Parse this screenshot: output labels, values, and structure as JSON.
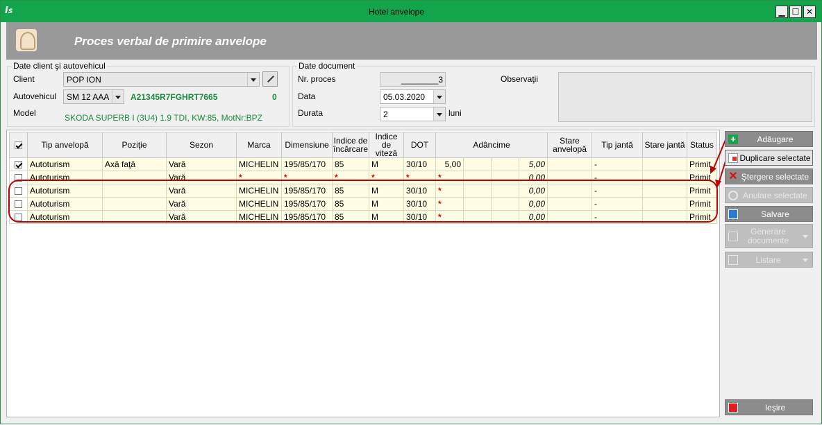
{
  "window": {
    "title": "Hotel anvelope",
    "min": "▁",
    "max": "☐",
    "close": "✕"
  },
  "header": {
    "title": "Proces verbal de primire anvelope"
  },
  "client_group": {
    "title": "Date client şi autovehicul",
    "client_label": "Client",
    "client_value": "POP ION",
    "vehicle_label": "Autovehicul",
    "vehicle_value": "SM 12 AAA",
    "vin": "A21345R7FGHRT7665",
    "vin_count": "0",
    "model_label": "Model",
    "model_value": "SKODA SUPERB I (3U4) 1.9 TDI, KW:85, MotNr:BPZ"
  },
  "document_group": {
    "title": "Date document",
    "nr_label": "Nr. proces",
    "nr_value": "________3",
    "date_label": "Data",
    "date_value": "05.03.2020",
    "duration_label": "Durata",
    "duration_value": "2",
    "duration_unit": "luni",
    "obs_label": "Observaţii"
  },
  "grid": {
    "headers": {
      "tip": "Tip anvelopă",
      "pozitie": "Poziţie",
      "sezon": "Sezon",
      "marca": "Marca",
      "dim": "Dimensiune",
      "incarcare": "Indice de încărcare",
      "viteza": "Indice de viteză",
      "dot": "DOT",
      "adancime": "Adâncime",
      "stare": "Stare anvelopă",
      "tip_janta": "Tip jantă",
      "stare_janta": "Stare jantă",
      "status": "Status"
    },
    "rows": [
      {
        "checked": true,
        "tip": "Autoturism",
        "pozitie": "Axă faţă",
        "sezon": "Vară",
        "marca": "MICHELIN",
        "dim": "195/85/170",
        "incarcare": "85",
        "viteza": "M",
        "dot": "30/10",
        "d1": "5,00",
        "total": "5,00",
        "tip_janta": "-",
        "status": "Primit"
      },
      {
        "checked": false,
        "tip": "Autoturism",
        "pozitie": "",
        "sezon": "Vară",
        "marca": "*",
        "dim": "*",
        "incarcare": "*",
        "viteza": "*",
        "dot": "*",
        "d1": "*",
        "total": "0,00",
        "tip_janta": "-",
        "status": "Primit"
      },
      {
        "checked": false,
        "tip": "Autoturism",
        "pozitie": "",
        "sezon": "Vară",
        "marca": "MICHELIN",
        "dim": "195/85/170",
        "incarcare": "85",
        "viteza": "M",
        "dot": "30/10",
        "d1": "*",
        "total": "0,00",
        "tip_janta": "-",
        "status": "Primit"
      },
      {
        "checked": false,
        "tip": "Autoturism",
        "pozitie": "",
        "sezon": "Vară",
        "marca": "MICHELIN",
        "dim": "195/85/170",
        "incarcare": "85",
        "viteza": "M",
        "dot": "30/10",
        "d1": "*",
        "total": "0,00",
        "tip_janta": "-",
        "status": "Primit"
      },
      {
        "checked": false,
        "tip": "Autoturism",
        "pozitie": "",
        "sezon": "Vară",
        "marca": "MICHELIN",
        "dim": "195/85/170",
        "incarcare": "85",
        "viteza": "M",
        "dot": "30/10",
        "d1": "*",
        "total": "0,00",
        "tip_janta": "-",
        "status": "Primit"
      }
    ]
  },
  "buttons": {
    "add": "Adăugare",
    "duplicate": "Duplicare selectate",
    "delete": "Ştergere selectate",
    "cancel": "Anulare selectate",
    "save": "Salvare",
    "generate": "Generare documente",
    "list": "Listare",
    "exit": "Ieşire"
  },
  "app_logo": "ISM",
  "colors": {
    "titlebar": "#13a54b",
    "accent_green": "#1a8a3c",
    "annotation_red": "#c00000",
    "row_bg": "#fffde3"
  }
}
